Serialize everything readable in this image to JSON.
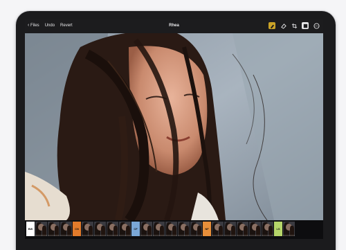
{
  "toolbar": {
    "back_label": "Files",
    "undo_label": "Undo",
    "revert_label": "Revert",
    "title": "Rhea",
    "icons": [
      "brush-icon",
      "eraser-icon",
      "crop-icon",
      "layers-icon",
      "more-icon"
    ],
    "accent_color": "#c9a227"
  },
  "filmstrip": {
    "groups": [
      {
        "label": "BW",
        "color": "#ffffff",
        "thumbs": 3
      },
      {
        "label": "CN",
        "color": "#e27b2b",
        "thumbs": 4
      },
      {
        "label": "CF",
        "color": "#7aa7d6",
        "thumbs": 5
      },
      {
        "label": "NF",
        "color": "#e88f3a",
        "thumbs": 5
      },
      {
        "label": "LS",
        "color": "#b6d66a",
        "thumbs": 1
      }
    ]
  }
}
